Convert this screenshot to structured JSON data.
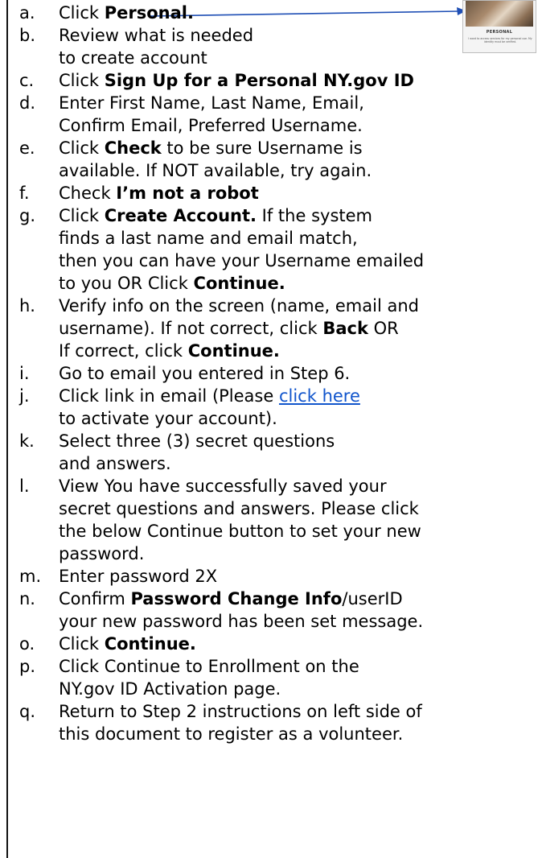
{
  "thumbnail": {
    "title": "PERSONAL",
    "description": "I want to access services for my personal use. My identity must be verified."
  },
  "colors": {
    "link": "#1155cc",
    "arrow": "#1f4fb5"
  },
  "steps": [
    {
      "letter": "a.",
      "lines": [
        [
          {
            "t": "Click "
          },
          {
            "t": "Personal.",
            "b": true
          }
        ]
      ]
    },
    {
      "letter": "b.",
      "lines": [
        [
          {
            "t": "Review what is needed"
          }
        ],
        [
          {
            "t": "to create  account"
          }
        ]
      ]
    },
    {
      "letter": "c.",
      "lines": [
        [
          {
            "t": "Click "
          },
          {
            "t": "Sign Up for a Personal NY.gov ID",
            "b": true
          }
        ]
      ]
    },
    {
      "letter": "d.",
      "lines": [
        [
          {
            "t": "Enter First Name, Last Name, Email,"
          }
        ],
        [
          {
            "t": "Confirm Email, Preferred Username."
          }
        ]
      ]
    },
    {
      "letter": "e.",
      "lines": [
        [
          {
            "t": "Click "
          },
          {
            "t": "Check",
            "b": true
          },
          {
            "t": " to be sure Username is"
          }
        ],
        [
          {
            "t": "available. If NOT available, try again."
          }
        ]
      ]
    },
    {
      "letter": "f.",
      "lines": [
        [
          {
            "t": "Check "
          },
          {
            "t": "I’m not a robot",
            "b": true
          }
        ]
      ]
    },
    {
      "letter": "g.",
      "lines": [
        [
          {
            "t": "Click "
          },
          {
            "t": "Create Account.",
            "b": true
          },
          {
            "t": " If the system"
          }
        ],
        [
          {
            "t": "finds a last name and email match,"
          }
        ],
        [
          {
            "t": "then you can have your Username emailed"
          }
        ],
        [
          {
            "t": "to you OR Click "
          },
          {
            "t": "Continue.",
            "b": true
          }
        ]
      ]
    },
    {
      "letter": "h.",
      "lines": [
        [
          {
            "t": "Verify info on the screen (name, email and"
          }
        ],
        [
          {
            "t": "username). If not correct, click "
          },
          {
            "t": "Back",
            "b": true
          },
          {
            "t": " OR"
          }
        ],
        [
          {
            "t": "If correct, click "
          },
          {
            "t": "Continue.",
            "b": true
          }
        ]
      ]
    },
    {
      "letter": "i.",
      "lines": [
        [
          {
            "t": "Go to email you entered in Step 6."
          }
        ]
      ]
    },
    {
      "letter": "j.",
      "lines": [
        [
          {
            "t": "Click link in email (Please "
          },
          {
            "t": "click here",
            "link": true
          }
        ],
        [
          {
            "t": "to activate your account)."
          }
        ]
      ]
    },
    {
      "letter": "k.",
      "lines": [
        [
          {
            "t": "Select three (3) secret questions"
          }
        ],
        [
          {
            "t": "and answers."
          }
        ]
      ]
    },
    {
      "letter": "l.",
      "lines": [
        [
          {
            "t": "View You have successfully saved your"
          }
        ],
        [
          {
            "t": "secret questions and answers. Please click"
          }
        ],
        [
          {
            "t": "the below Continue button to set your new"
          }
        ],
        [
          {
            "t": "password."
          }
        ]
      ]
    },
    {
      "letter": "m.",
      "lines": [
        [
          {
            "t": "Enter password 2X"
          }
        ]
      ]
    },
    {
      "letter": "n.",
      "lines": [
        [
          {
            "t": "Confirm "
          },
          {
            "t": "Password Change Info",
            "b": true
          },
          {
            "t": "/userID"
          }
        ],
        [
          {
            "t": "your new password has been set message."
          }
        ]
      ]
    },
    {
      "letter": "o.",
      "lines": [
        [
          {
            "t": "Click "
          },
          {
            "t": "Continue.",
            "b": true
          }
        ]
      ]
    },
    {
      "letter": "p.",
      "lines": [
        [
          {
            "t": "Click Continue to Enrollment on the"
          }
        ],
        [
          {
            "t": "NY.gov ID Activation page."
          }
        ]
      ]
    },
    {
      "letter": "q.",
      "lines": [
        [
          {
            "t": "Return to Step 2 instructions on left side of"
          }
        ],
        [
          {
            "t": "this document to register as a volunteer."
          }
        ]
      ]
    }
  ]
}
